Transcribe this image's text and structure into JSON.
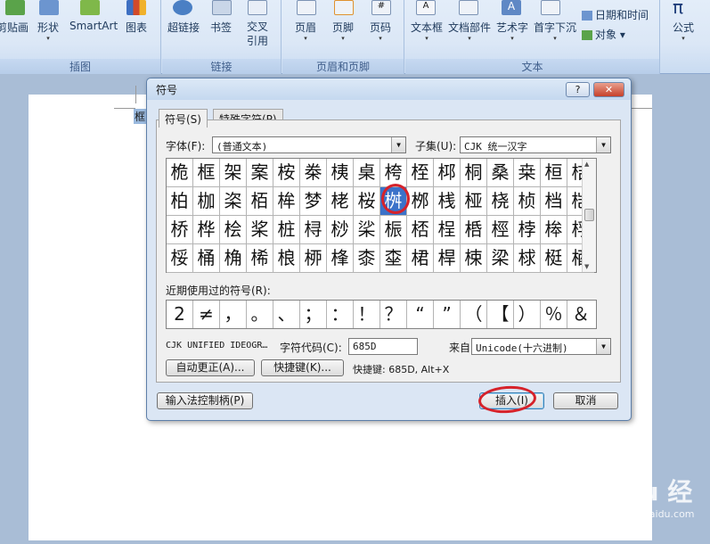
{
  "ribbon": {
    "groups": [
      {
        "label": "插图",
        "buttons": [
          "剪贴画",
          "形状",
          "SmartArt",
          "图表"
        ]
      },
      {
        "label": "链接",
        "buttons": [
          "超链接",
          "书签",
          "交叉引用"
        ]
      },
      {
        "label": "页眉和页脚",
        "buttons": [
          "页眉",
          "页脚",
          "页码"
        ]
      },
      {
        "label": "文本",
        "buttons": [
          "文本框",
          "文档部件",
          "艺术字",
          "首字下沉"
        ]
      }
    ],
    "small_buttons": [
      "日期和时间",
      "对象"
    ],
    "formula_label": "公式"
  },
  "document": {
    "selected_char": "框"
  },
  "dialog": {
    "title": "符号",
    "help": "?",
    "close": "✕",
    "tabs": [
      "符号(S)",
      "特殊字符(P)"
    ],
    "font_label": "字体(F):",
    "font_value": "(普通文本)",
    "subset_label": "子集(U):",
    "subset_value": "CJK 统一汉字",
    "grid": [
      [
        "桅",
        "框",
        "架",
        "案",
        "桉",
        "桊",
        "桋",
        "桌",
        "桍",
        "桎",
        "桏",
        "桐",
        "桑",
        "桒",
        "桓",
        "桔"
      ],
      [
        "柏",
        "枷",
        "栥",
        "栢",
        "桙",
        "梦",
        "栳",
        "桜",
        "桝",
        "桞",
        "桟",
        "桠",
        "桡",
        "桢",
        "档",
        "桤"
      ],
      [
        "桥",
        "桦",
        "桧",
        "桨",
        "桩",
        "桪",
        "桫",
        "桬",
        "桭",
        "桮",
        "桯",
        "桰",
        "桱",
        "桲",
        "桳",
        "桴"
      ],
      [
        "桵",
        "桶",
        "桷",
        "桸",
        "桹",
        "桺",
        "桻",
        "桼",
        "桽",
        "桾",
        "桿",
        "梀",
        "梁",
        "梂",
        "梃",
        "梄"
      ]
    ],
    "selected_index": [
      1,
      8
    ],
    "recent_label": "近期使用过的符号(R):",
    "recent": [
      "2",
      "≠",
      "，",
      "。",
      "、",
      "；",
      "：",
      "！",
      "？",
      "“",
      "”",
      "（",
      "【",
      "）",
      "％",
      "＆"
    ],
    "char_name": "CJK UNIFIED IDEOGR…",
    "charcode_label": "字符代码(C):",
    "charcode_value": "685D",
    "from_label": "来自(M):",
    "from_value": "Unicode(十六进制)",
    "autocorrect_btn": "自动更正(A)...",
    "shortcut_btn": "快捷键(K)...",
    "shortcut_text": "快捷键: 685D, Alt+X",
    "ime_btn": "输入法控制柄(P)",
    "insert_btn": "插入(I)",
    "cancel_btn": "取消"
  },
  "watermark": {
    "main": "Bai du 经验",
    "sub": "jingyan.baidu.com"
  }
}
